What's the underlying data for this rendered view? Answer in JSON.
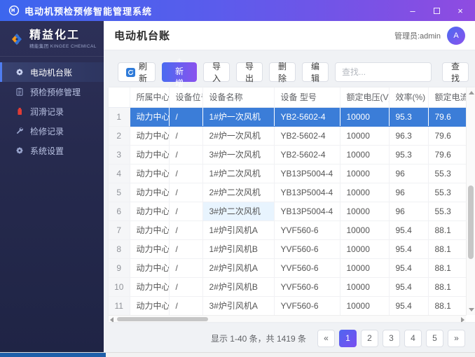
{
  "titlebar": {
    "title": "电动机预检预修智能管理系统",
    "minimize_label": "–",
    "close_label": "×"
  },
  "sidebar": {
    "logo": {
      "name": "精益化工",
      "subtitle": "精能集团 KINGEE CHEMICAL"
    },
    "items": [
      {
        "label": "电动机台账",
        "icon": "gear-icon",
        "active": true
      },
      {
        "label": "预检预修管理",
        "icon": "clipboard-icon",
        "active": false
      },
      {
        "label": "润滑记录",
        "icon": "oil-icon",
        "active": false
      },
      {
        "label": "检修记录",
        "icon": "wrench-icon",
        "active": false
      },
      {
        "label": "系统设置",
        "icon": "gear-icon",
        "active": false
      }
    ]
  },
  "header": {
    "title": "电动机台账",
    "user_label": "管理员:admin",
    "avatar_text": "A"
  },
  "toolbar": {
    "refresh": "刷新",
    "add": "+ 新增",
    "import": "导入",
    "export": "导出",
    "delete": "删除",
    "edit": "编辑",
    "search_placeholder": "查找...",
    "search_button": "查找"
  },
  "icons": [
    "app-logo-icon",
    "minimize-icon",
    "maximize-icon",
    "close-icon",
    "diamond-logo-icon",
    "gear-icon",
    "clipboard-icon",
    "oil-icon",
    "wrench-icon",
    "refresh-icon",
    "scroll-up-icon",
    "scroll-down-icon",
    "scroll-left-icon",
    "scroll-right-icon"
  ],
  "colors": {
    "titlebar_gradient_start": "#3c66ee",
    "titlebar_gradient_end": "#8f4be1",
    "sidebar_bg": "#262a4e",
    "accent_gradient_start": "#4a6bf0",
    "accent_gradient_end": "#8a52ee",
    "selected_row": "#3b7dd8",
    "oil_icon_red": "#e03c36",
    "bottom_strip_blue": "#1e5fa9"
  },
  "table": {
    "columns": [
      "所属中心",
      "设备位号",
      "设备名称",
      "设备 型号",
      "额定电压(V)",
      "效率(%)",
      "额定电流(A)"
    ],
    "rows": [
      {
        "num": "1",
        "center": "动力中心",
        "pos": "/",
        "name": "1#炉一次风机",
        "model": "YB2-5602-4",
        "voltage": "10000",
        "eff": "95.3",
        "current": "79.6",
        "selected": true,
        "hl_name": false
      },
      {
        "num": "2",
        "center": "动力中心",
        "pos": "/",
        "name": "2#炉一次风机",
        "model": "YB2-5602-4",
        "voltage": "10000",
        "eff": "96.3",
        "current": "79.6",
        "selected": false,
        "hl_name": false
      },
      {
        "num": "3",
        "center": "动力中心",
        "pos": "/",
        "name": "3#炉一次风机",
        "model": "YB2-5602-4",
        "voltage": "10000",
        "eff": "95.3",
        "current": "79.6",
        "selected": false,
        "hl_name": false
      },
      {
        "num": "4",
        "center": "动力中心",
        "pos": "/",
        "name": "1#炉二次风机",
        "model": "YB13P5004-4",
        "voltage": "10000",
        "eff": "96",
        "current": "55.3",
        "selected": false,
        "hl_name": false
      },
      {
        "num": "5",
        "center": "动力中心",
        "pos": "/",
        "name": "2#炉二次风机",
        "model": "YB13P5004-4",
        "voltage": "10000",
        "eff": "96",
        "current": "55.3",
        "selected": false,
        "hl_name": false
      },
      {
        "num": "6",
        "center": "动力中心",
        "pos": "/",
        "name": "3#炉二次风机",
        "model": "YB13P5004-4",
        "voltage": "10000",
        "eff": "96",
        "current": "55.3",
        "selected": false,
        "hl_name": true
      },
      {
        "num": "7",
        "center": "动力中心",
        "pos": "/",
        "name": "1#炉引风机A",
        "model": "YVF560-6",
        "voltage": "10000",
        "eff": "95.4",
        "current": "88.1",
        "selected": false,
        "hl_name": false
      },
      {
        "num": "8",
        "center": "动力中心",
        "pos": "/",
        "name": "1#炉引风机B",
        "model": "YVF560-6",
        "voltage": "10000",
        "eff": "95.4",
        "current": "88.1",
        "selected": false,
        "hl_name": false
      },
      {
        "num": "9",
        "center": "动力中心",
        "pos": "/",
        "name": "2#炉引风机A",
        "model": "YVF560-6",
        "voltage": "10000",
        "eff": "95.4",
        "current": "88.1",
        "selected": false,
        "hl_name": false
      },
      {
        "num": "10",
        "center": "动力中心",
        "pos": "/",
        "name": "2#炉引风机B",
        "model": "YVF560-6",
        "voltage": "10000",
        "eff": "95.4",
        "current": "88.1",
        "selected": false,
        "hl_name": false
      },
      {
        "num": "11",
        "center": "动力中心",
        "pos": "/",
        "name": "3#炉引风机A",
        "model": "YVF560-6",
        "voltage": "10000",
        "eff": "95.4",
        "current": "88.1",
        "selected": false,
        "hl_name": false
      }
    ]
  },
  "pagination": {
    "summary": "显示 1-40 条，共 1419 条",
    "prev": "«",
    "pages": [
      "1",
      "2",
      "3",
      "4",
      "5"
    ],
    "next": "»",
    "active_page": "1"
  }
}
